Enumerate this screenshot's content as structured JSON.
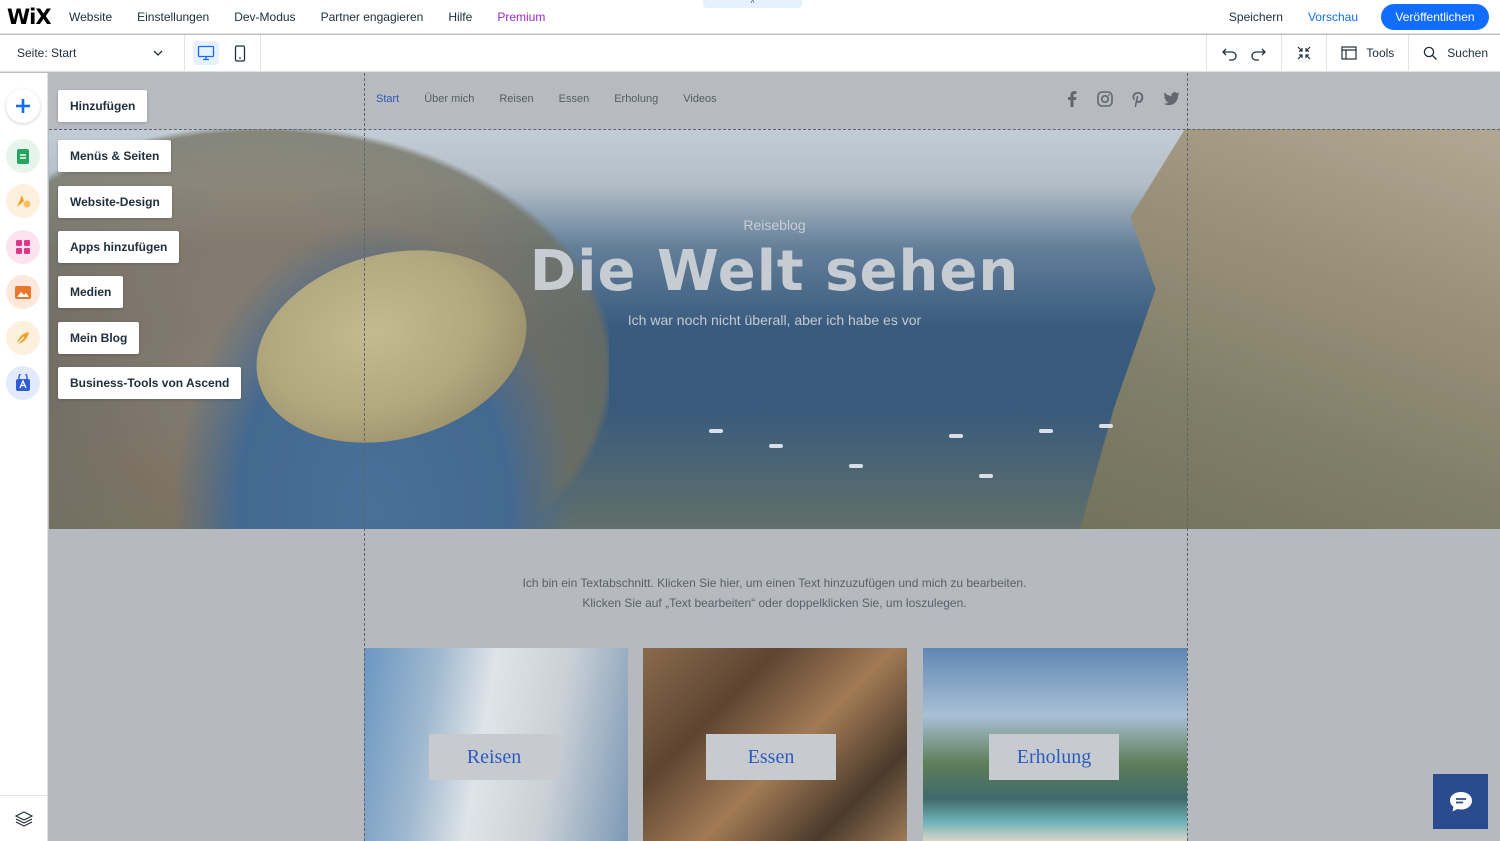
{
  "app": {
    "logo": "WiX"
  },
  "topbar": {
    "menu": [
      "Website",
      "Einstellungen",
      "Dev-Modus",
      "Partner engagieren",
      "Hilfe",
      "Premium"
    ],
    "pull_tab": "˄",
    "save": "Speichern",
    "preview": "Vorschau",
    "publish": "Veröffentlichen"
  },
  "toolbar": {
    "page_label": "Seite:",
    "page_value": "Start",
    "tools": "Tools",
    "search": "Suchen"
  },
  "sidebar": {
    "items": [
      {
        "label": "Hinzufügen",
        "icon": "plus-icon",
        "color": "#116dff",
        "bg": "#ffffff"
      },
      {
        "label": "Menüs & Seiten",
        "icon": "pages-icon",
        "color": "#25a55f",
        "bg": "#e6f5ec"
      },
      {
        "label": "Website-Design",
        "icon": "design-icon",
        "color": "#f0a030",
        "bg": "#fdf0dc"
      },
      {
        "label": "Apps hinzufügen",
        "icon": "apps-icon",
        "color": "#e0368a",
        "bg": "#fbe4ef"
      },
      {
        "label": "Medien",
        "icon": "media-icon",
        "color": "#e9762b",
        "bg": "#fde9dc"
      },
      {
        "label": "Mein Blog",
        "icon": "blog-icon",
        "color": "#f0a030",
        "bg": "#fdf0dc"
      },
      {
        "label": "Business-Tools von Ascend",
        "icon": "ascend-icon",
        "color": "#2f5dd6",
        "bg": "#e3eafc"
      }
    ]
  },
  "site": {
    "nav": [
      "Start",
      "Über mich",
      "Reisen",
      "Essen",
      "Erholung",
      "Videos"
    ],
    "social": [
      "facebook-icon",
      "instagram-icon",
      "pinterest-icon",
      "twitter-icon"
    ],
    "hero": {
      "subtitle": "Reiseblog",
      "title": "Die Welt sehen",
      "tagline": "Ich war noch nicht überall, aber ich habe es vor"
    },
    "intro_line1": "Ich bin ein Textabschnitt. Klicken Sie hier, um einen Text hinzuzufügen und mich zu bearbeiten.",
    "intro_line2": "Klicken Sie auf „Text bearbeiten“ oder doppelklicken Sie, um loszulegen.",
    "cards": [
      "Reisen",
      "Essen",
      "Erholung"
    ]
  },
  "colors": {
    "accent": "#116dff",
    "premium": "#9a27d5",
    "nav_active": "#2e58b8",
    "chat": "#2a4c8f"
  }
}
